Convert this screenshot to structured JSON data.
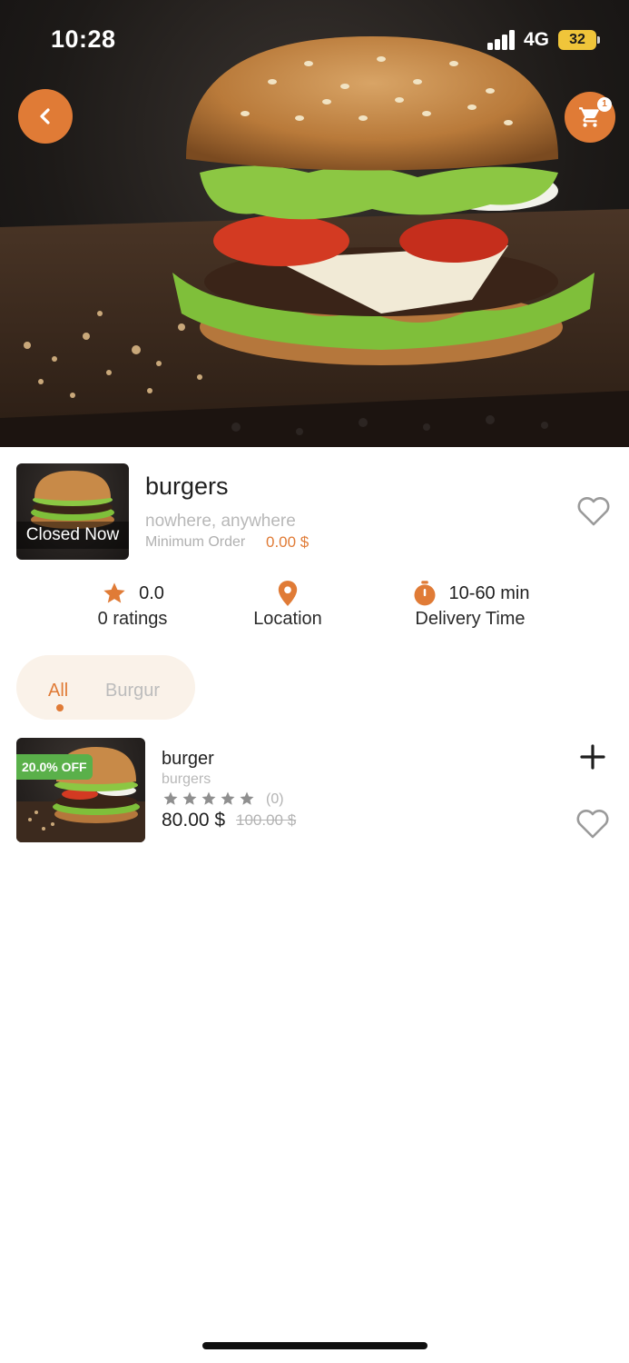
{
  "status_bar": {
    "time": "10:28",
    "network": "4G",
    "battery": "32"
  },
  "header": {
    "back_icon": "chevron-left-icon",
    "cart_icon": "cart-icon",
    "cart_count": "1",
    "accent_color": "#e07b36"
  },
  "store": {
    "name": "burgers",
    "status_label": "Closed Now",
    "address": "nowhere, anywhere",
    "min_order_label": "Minimum Order",
    "min_order_value": "0.00 $",
    "favorite_icon": "heart-outline-icon"
  },
  "stats": {
    "rating_value": "0.0",
    "rating_label": "0 ratings",
    "location_label": "Location",
    "delivery_value": "10-60 min",
    "delivery_label": "Delivery Time"
  },
  "tabs": [
    {
      "label": "All",
      "active": true
    },
    {
      "label": "Burgur",
      "active": false
    }
  ],
  "products": [
    {
      "name": "burger",
      "category": "burgers",
      "discount": "20.0% OFF",
      "rating_count": "(0)",
      "rating_stars": 0,
      "price": "80.00 $",
      "old_price": "100.00 $",
      "add_icon": "plus-icon",
      "favorite_icon": "heart-outline-icon"
    }
  ],
  "colors": {
    "accent": "#e07b36",
    "discount": "#5ab04a",
    "muted": "#b8b8b8"
  }
}
